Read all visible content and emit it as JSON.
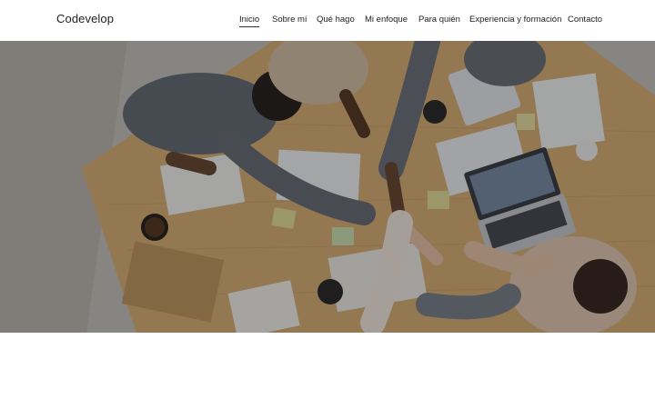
{
  "brand": {
    "name": "Codevelop"
  },
  "nav": {
    "items": [
      {
        "label": "Inicio",
        "active": true
      },
      {
        "label": "Sobre mí"
      },
      {
        "label": "Qué hago"
      },
      {
        "label": "Mi enfoque"
      },
      {
        "label": "Para quién"
      },
      {
        "label": "Experiencia y formación"
      },
      {
        "label": "Contacto"
      }
    ]
  },
  "hero": {
    "image": "team-meeting-high-five-photo",
    "overlay_color": "#000000",
    "colors": {
      "table": "#d7b07a",
      "floor": "#c9c5bf"
    }
  }
}
